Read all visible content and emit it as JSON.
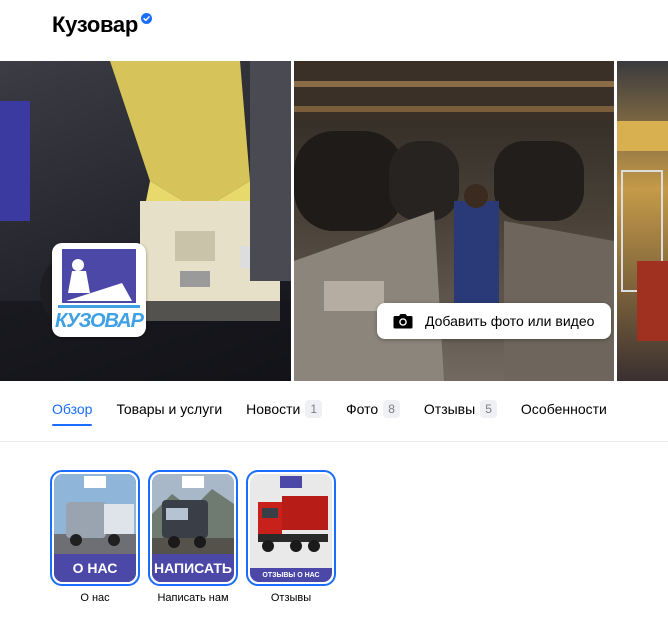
{
  "header": {
    "title": "Кузовар"
  },
  "gallery": {
    "add_media_label": "Добавить фото или видео"
  },
  "logo": {
    "text": "КУЗОВАР"
  },
  "tabs": [
    {
      "label": "Обзор",
      "count": ""
    },
    {
      "label": "Товары и услуги",
      "count": ""
    },
    {
      "label": "Новости",
      "count": "1"
    },
    {
      "label": "Фото",
      "count": "8"
    },
    {
      "label": "Отзывы",
      "count": "5"
    },
    {
      "label": "Особенности",
      "count": ""
    }
  ],
  "stories": [
    {
      "overlay": "О НАС",
      "caption": "О нас"
    },
    {
      "overlay": "НАПИСАТЬ",
      "caption": "Написать нам"
    },
    {
      "overlay": "ОТЗЫВЫ О НАС",
      "caption": "Отзывы"
    }
  ],
  "colors": {
    "accent": "#196dff",
    "story_band": "#4b48a8",
    "logo_text": "#3fa0e6",
    "verified": "#196dff"
  },
  "icons": {
    "verified": "verified-badge-icon",
    "camera": "camera-icon"
  }
}
